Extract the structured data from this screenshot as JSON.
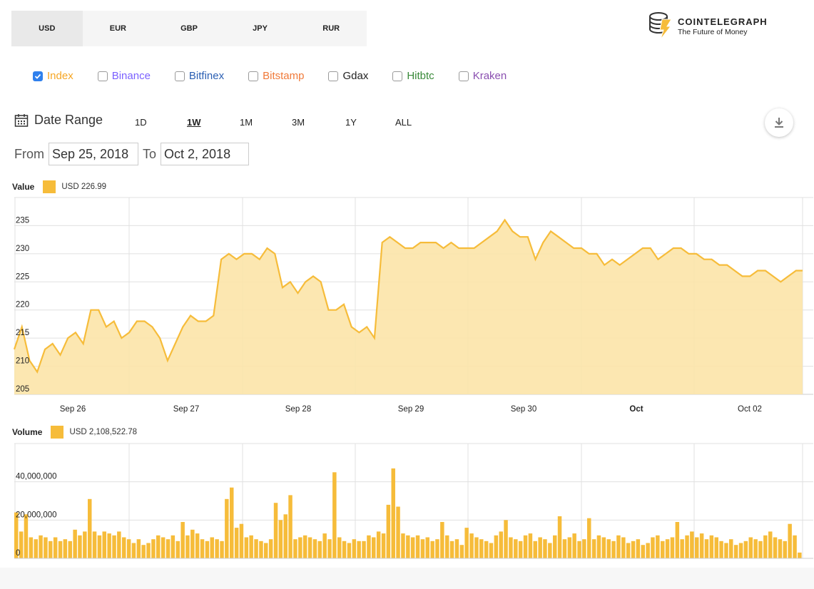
{
  "currencies": [
    "USD",
    "EUR",
    "GBP",
    "JPY",
    "RUR"
  ],
  "brand": {
    "title": "COINTELEGRAPH",
    "subtitle": "The Future of Money"
  },
  "exchanges": [
    {
      "label": "Index",
      "checked": true,
      "color": "#f6a623"
    },
    {
      "label": "Binance",
      "checked": false,
      "color": "#7b61ff"
    },
    {
      "label": "Bitfinex",
      "checked": false,
      "color": "#2b5fb3"
    },
    {
      "label": "Bitstamp",
      "checked": false,
      "color": "#f07a3a"
    },
    {
      "label": "Gdax",
      "checked": false,
      "color": "#222222"
    },
    {
      "label": "Hitbtc",
      "checked": false,
      "color": "#3a8a3a"
    },
    {
      "label": "Kraken",
      "checked": false,
      "color": "#8a4fb0"
    }
  ],
  "date_range": {
    "label": "Date Range",
    "options": [
      "1D",
      "1W",
      "1M",
      "3M",
      "1Y",
      "ALL"
    ],
    "active": "1W",
    "from_label": "From",
    "from": "Sep 25, 2018",
    "to_label": "To",
    "to": "Oct 2, 2018"
  },
  "colors": {
    "series": "#f6bc3a",
    "area": "#fce4a8",
    "grid": "#e0e0e0"
  },
  "chart_data": [
    {
      "type": "area",
      "title": "Value",
      "legend": "USD 226.99",
      "ylim": [
        205,
        240
      ],
      "yticks": [
        205,
        210,
        215,
        220,
        225,
        230,
        235
      ],
      "xticks": [
        "Sep 26",
        "Sep 27",
        "Sep 28",
        "Sep 29",
        "Sep 30",
        "Oct",
        "Oct 02"
      ],
      "x_range": [
        0,
        7.2
      ],
      "x": [
        0,
        0.07,
        0.14,
        0.21,
        0.28,
        0.35,
        0.42,
        0.49,
        0.56,
        0.63,
        0.7,
        0.77,
        0.84,
        0.91,
        0.98,
        1.05,
        1.12,
        1.19,
        1.26,
        1.33,
        1.4,
        1.47,
        1.54,
        1.61,
        1.68,
        1.75,
        1.82,
        1.89,
        1.96,
        2.03,
        2.1,
        2.17,
        2.24,
        2.31,
        2.38,
        2.45,
        2.52,
        2.59,
        2.66,
        2.73,
        2.8,
        2.87,
        2.94,
        3.01,
        3.08,
        3.15,
        3.22,
        3.29,
        3.36,
        3.43,
        3.5,
        3.57,
        3.64,
        3.71,
        3.78,
        3.85,
        3.92,
        3.99,
        4.06,
        4.13,
        4.2,
        4.27,
        4.34,
        4.41,
        4.48,
        4.55,
        4.62,
        4.69,
        4.76,
        4.83,
        4.9,
        4.97,
        5.04,
        5.11,
        5.18,
        5.25,
        5.32,
        5.39,
        5.46,
        5.53,
        5.6,
        5.67,
        5.74,
        5.81,
        5.88,
        5.95,
        6.02,
        6.09,
        6.16,
        6.23,
        6.3,
        6.37,
        6.44,
        6.51,
        6.58,
        6.65,
        6.72,
        6.79,
        6.86,
        6.93,
        7.0,
        7.07,
        7.14,
        7.2
      ],
      "values": [
        213,
        217,
        211,
        209,
        213,
        214,
        212,
        215,
        216,
        214,
        220,
        220,
        217,
        218,
        215,
        216,
        218,
        218,
        217,
        215,
        211,
        214,
        217,
        219,
        218,
        218,
        219,
        229,
        230,
        229,
        230,
        230,
        229,
        231,
        230,
        224,
        225,
        223,
        225,
        226,
        225,
        220,
        220,
        221,
        217,
        216,
        217,
        215,
        232,
        233,
        232,
        231,
        231,
        232,
        232,
        232,
        231,
        232,
        231,
        231,
        231,
        232,
        233,
        234,
        236,
        234,
        233,
        233,
        229,
        232,
        234,
        233,
        232,
        231,
        231,
        230,
        230,
        228,
        229,
        228,
        229,
        230,
        231,
        231,
        229,
        230,
        231,
        231,
        230,
        230,
        229,
        229,
        228,
        228,
        227,
        226,
        226,
        227,
        227,
        226,
        225,
        226,
        227,
        227
      ]
    },
    {
      "type": "bar",
      "title": "Volume",
      "legend": "USD 2,108,522.78",
      "ylim": [
        0,
        60000000
      ],
      "yticks_labels": [
        "0",
        "20,000,000",
        "40,000,000"
      ],
      "yticks": [
        0,
        20000000,
        40000000
      ],
      "xticks": [
        "Sep 26",
        "Sep 27",
        "Sep 28",
        "Sep 29",
        "Sep 30",
        "Oct",
        "Oct 02"
      ],
      "x_range": [
        0,
        7.2
      ],
      "values": [
        24000000,
        14000000,
        23000000,
        11000000,
        10000000,
        12000000,
        11000000,
        9000000,
        11000000,
        9000000,
        10000000,
        9000000,
        15000000,
        12000000,
        14000000,
        31000000,
        14000000,
        12000000,
        14000000,
        13000000,
        12000000,
        14000000,
        11000000,
        10000000,
        8000000,
        10000000,
        7000000,
        8000000,
        10000000,
        12000000,
        11000000,
        10000000,
        12000000,
        9000000,
        19000000,
        12000000,
        15000000,
        13000000,
        10000000,
        9000000,
        11000000,
        10000000,
        9000000,
        31000000,
        37000000,
        16000000,
        18000000,
        11000000,
        12000000,
        10000000,
        9000000,
        8000000,
        10000000,
        29000000,
        20000000,
        23000000,
        33000000,
        10000000,
        11000000,
        12000000,
        11000000,
        10000000,
        9000000,
        13000000,
        10000000,
        45000000,
        11000000,
        9000000,
        8000000,
        10000000,
        9000000,
        9000000,
        12000000,
        11000000,
        14000000,
        13000000,
        28000000,
        47000000,
        27000000,
        13000000,
        12000000,
        11000000,
        12000000,
        10000000,
        11000000,
        9000000,
        10000000,
        19000000,
        12000000,
        9000000,
        10000000,
        7000000,
        16000000,
        13000000,
        11000000,
        10000000,
        9000000,
        8000000,
        12000000,
        14000000,
        20000000,
        11000000,
        10000000,
        9000000,
        12000000,
        13000000,
        9000000,
        11000000,
        10000000,
        8000000,
        12000000,
        22000000,
        10000000,
        11000000,
        13000000,
        9000000,
        10000000,
        21000000,
        10000000,
        12000000,
        11000000,
        10000000,
        9000000,
        12000000,
        11000000,
        8000000,
        9000000,
        10000000,
        7000000,
        8000000,
        11000000,
        12000000,
        9000000,
        10000000,
        11000000,
        19000000,
        10000000,
        12000000,
        14000000,
        11000000,
        13000000,
        10000000,
        12000000,
        11000000,
        9000000,
        8000000,
        10000000,
        7000000,
        8000000,
        9000000,
        11000000,
        10000000,
        9000000,
        12000000,
        14000000,
        11000000,
        10000000,
        9000000,
        18000000,
        12000000,
        3000000
      ]
    }
  ]
}
